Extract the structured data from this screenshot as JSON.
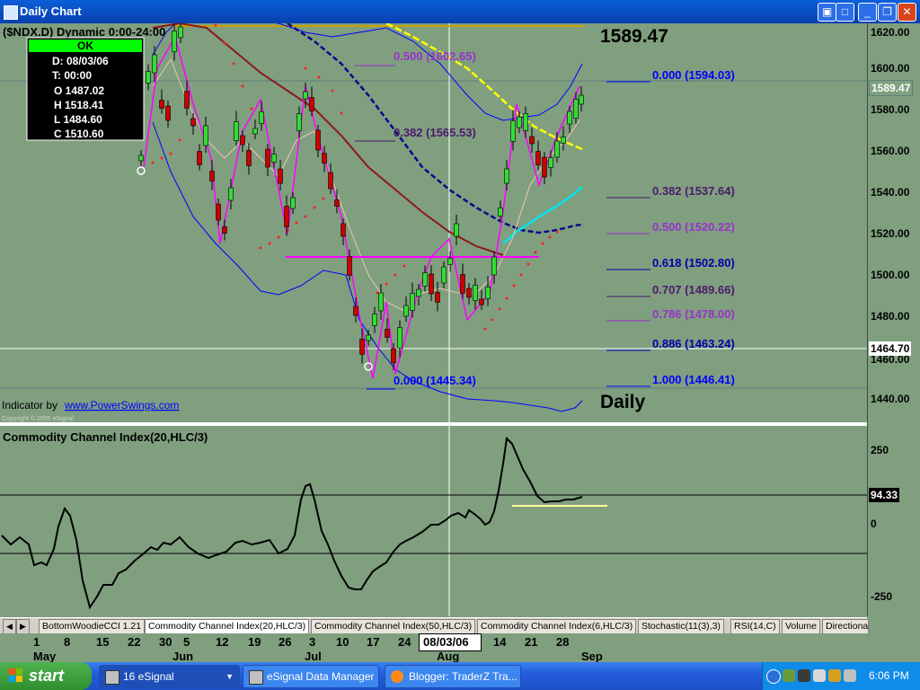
{
  "window": {
    "title": "Daily Chart"
  },
  "chart": {
    "symbol_label": "($NDX.D) Dynamic 0:00-24:00",
    "last_price": "1589.47",
    "period_label": "Daily",
    "indicator_credit": "Indicator by",
    "indicator_link": "www.PowerSwings.com",
    "copyright": "Copyright © 2005 eSignal",
    "cursor": {
      "ok": "OK",
      "date": "D: 08/03/06",
      "time": "T: 00:00",
      "open": "O 1487.02",
      "high": "H 1518.41",
      "low": "L 1484.60",
      "close": "C 1510.60"
    },
    "fib_left": [
      {
        "label": "0.500 (1602.65)",
        "color": "#9932cc"
      },
      {
        "label": "0.382 (1565.53)",
        "color": "#4b1a6b"
      },
      {
        "label": "0.000 (1445.34)",
        "color": "#0000ff"
      }
    ],
    "fib_right": [
      {
        "label": "0.000 (1594.03)",
        "color": "#0000ff"
      },
      {
        "label": "0.382 (1537.64)",
        "color": "#4b1a6b"
      },
      {
        "label": "0.500 (1520.22)",
        "color": "#9932cc"
      },
      {
        "label": "0.618 (1502.80)",
        "color": "#0000aa"
      },
      {
        "label": "0.707 (1489.66)",
        "color": "#4b1a6b"
      },
      {
        "label": "0.786 (1478.00)",
        "color": "#9932cc"
      },
      {
        "label": "0.886 (1463.24)",
        "color": "#0000aa"
      },
      {
        "label": "1.000 (1446.41)",
        "color": "#0000ff"
      }
    ],
    "price_axis": [
      "1620.00",
      "1600.00",
      "1580.00",
      "1560.00",
      "1540.00",
      "1520.00",
      "1500.00",
      "1480.00",
      "1460.00",
      "1440.00"
    ],
    "price_marker": "1464.70",
    "current_price_box": "1589.47",
    "cci_title": "Commodity Channel Index(20,HLC/3)",
    "cci_axis": [
      "250",
      "0",
      "-250"
    ],
    "cci_value": "94.33"
  },
  "tabs": [
    "BottomWoodieCCI 1.21",
    "Commodity Channel Index(20,HLC/3)",
    "Commodity Channel Index(50,HLC/3)",
    "Commodity Channel Index(6,HLC/3)",
    "Stochastic(11(3),3)",
    "RSI(14,C)",
    "Volume",
    "Directiona"
  ],
  "date_axis": {
    "days": [
      "1",
      "8",
      "15",
      "22",
      "30",
      "5",
      "12",
      "19",
      "26",
      "3",
      "10",
      "17",
      "24",
      "08/03/06",
      "14",
      "21",
      "28"
    ],
    "months": [
      "May",
      "Jun",
      "Jul",
      "Aug",
      "Sep"
    ]
  },
  "taskbar": {
    "start": "start",
    "buttons": [
      "16 eSignal",
      "eSignal Data Manager",
      "Blogger: TraderZ Tra..."
    ],
    "clock": "6:06 PM"
  },
  "colors": {
    "chart_bg": "#7f9f7f",
    "up_candle": "#33dd33",
    "down_candle": "#cc0000",
    "accent": "#245edb"
  }
}
